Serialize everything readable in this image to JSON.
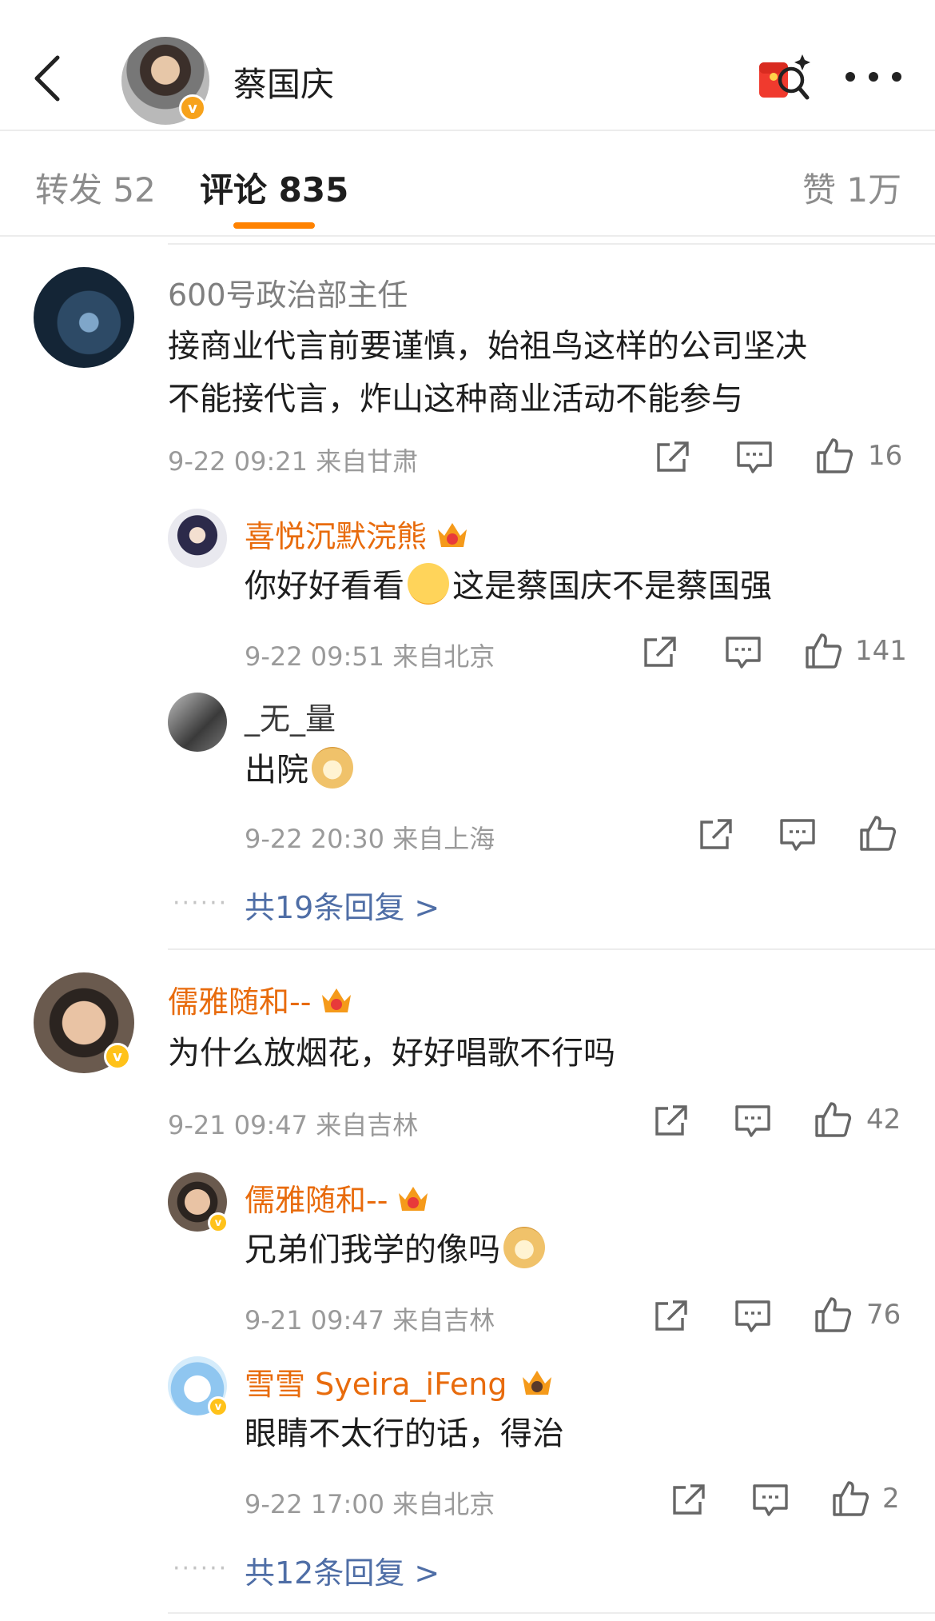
{
  "header": {
    "title": "蔡国庆"
  },
  "tabs": [
    {
      "label": "转发 52"
    },
    {
      "label": "评论 835"
    },
    {
      "label": "赞 1万"
    }
  ],
  "comments": [
    {
      "user": "600号政治部主任",
      "lines": [
        "接商业代言前要谨慎，始祖鸟这样的公司坚决",
        "不能接代言，炸山这种商业活动不能参与"
      ],
      "meta": "9-22 09:21  来自甘肃",
      "likes": "16",
      "replies": [
        {
          "user": "喜悦沉默浣熊",
          "text_a": "你好好看看",
          "text_b": "这是蔡国庆不是蔡国强",
          "meta": "9-22 09:51  来自北京",
          "likes": "141"
        },
        {
          "user": "_无_量",
          "text_a": "出院",
          "meta": "9-22 20:30  来自上海",
          "likes": ""
        }
      ],
      "more_replies": "共19条回复 >"
    },
    {
      "user": "儒雅随和--",
      "lines": [
        "为什么放烟花，好好唱歌不行吗"
      ],
      "meta": "9-21 09:47  来自吉林",
      "likes": "42",
      "replies": [
        {
          "user": "儒雅随和--",
          "text_a": "兄弟们我学的像吗",
          "meta": "9-21 09:47  来自吉林",
          "likes": "76"
        },
        {
          "user": "雪雪 Syeira_iFeng",
          "text_a": "眼睛不太行的话，得治",
          "meta": "9-22 17:00  来自北京",
          "likes": "2"
        }
      ],
      "more_replies": "共12条回复 >"
    }
  ],
  "colors": {
    "accent": "#ff8200",
    "username_orange": "#e86b0c",
    "link_blue": "#4f6ea6",
    "verified": "#f7a21b"
  },
  "icons": [
    "back-arrow-icon",
    "red-envelope-search-icon",
    "more-icon",
    "share-icon",
    "comment-icon",
    "like-icon",
    "crown-badge-icon",
    "verified-icon"
  ]
}
